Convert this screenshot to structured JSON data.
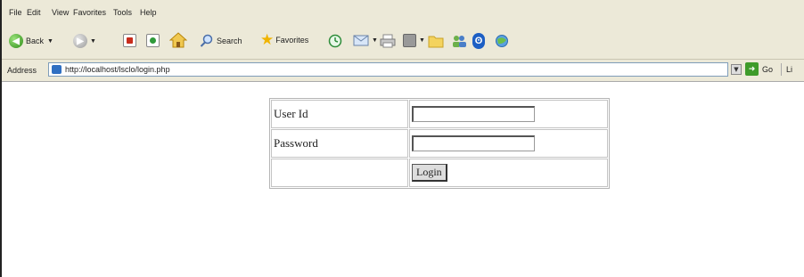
{
  "menu": [
    "File",
    "Edit",
    "View",
    "Favorites",
    "Tools",
    "Help"
  ],
  "toolbar": {
    "back_label": "Back",
    "search_label": "Search",
    "favorites_label": "Favorites"
  },
  "address": {
    "label": "Address",
    "url": "http://localhost/lsclo/login.php",
    "go_label": "Go",
    "links_label": "Li"
  },
  "form": {
    "userid_label": "User Id",
    "password_label": "Password",
    "userid_value": "",
    "password_value": "",
    "login_button": "Login"
  }
}
